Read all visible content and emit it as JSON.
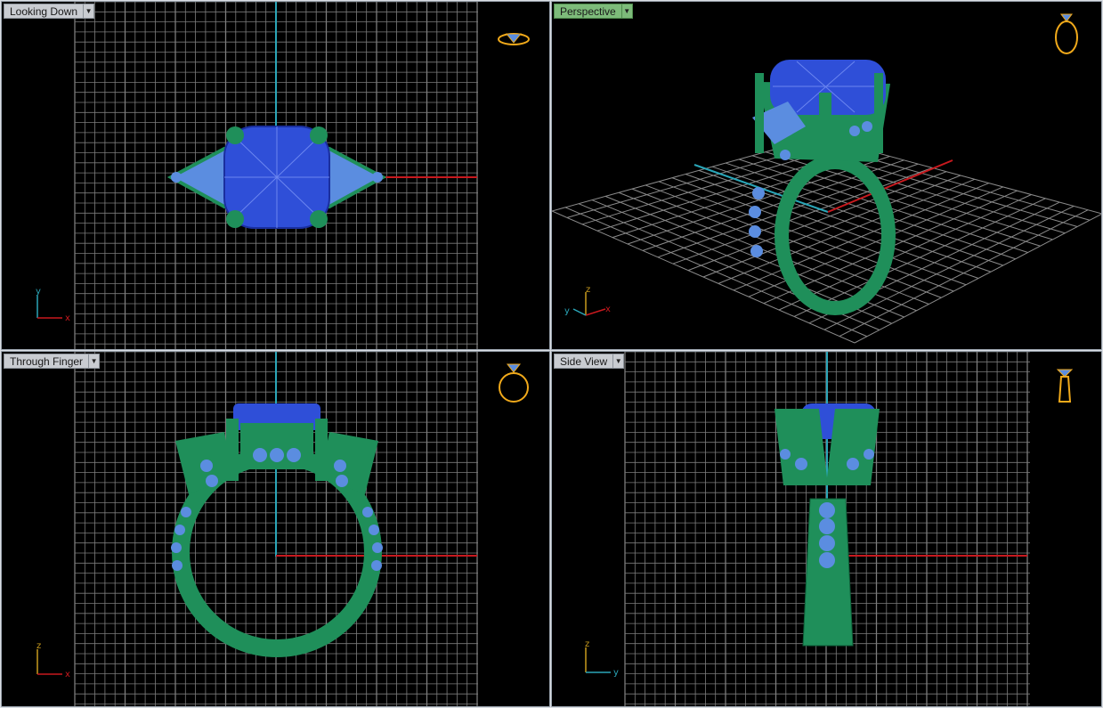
{
  "viewports": [
    {
      "title": "Looking Down",
      "active": false,
      "axes": [
        "x",
        "y"
      ]
    },
    {
      "title": "Perspective",
      "active": true,
      "axes": [
        "x",
        "y",
        "z"
      ]
    },
    {
      "title": "Through Finger",
      "active": false,
      "axes": [
        "x",
        "z"
      ]
    },
    {
      "title": "Side View",
      "active": false,
      "axes": [
        "y",
        "z"
      ]
    }
  ],
  "icons": {
    "tab_menu": "chevron-down-icon",
    "nav_widget": "ring-view-icon"
  },
  "colors": {
    "background": "#000000",
    "grid": "#8a8a8a",
    "axis_x": "#c8191e",
    "axis_y": "#2aa6b8",
    "axis_z": "#c89b1e",
    "metal": "#1f8f5a",
    "gem": "#2f4fd8",
    "side_gems": "#5b8de0",
    "nav_widget": "#f0a91a",
    "active_tab": "#7dbb7a"
  }
}
